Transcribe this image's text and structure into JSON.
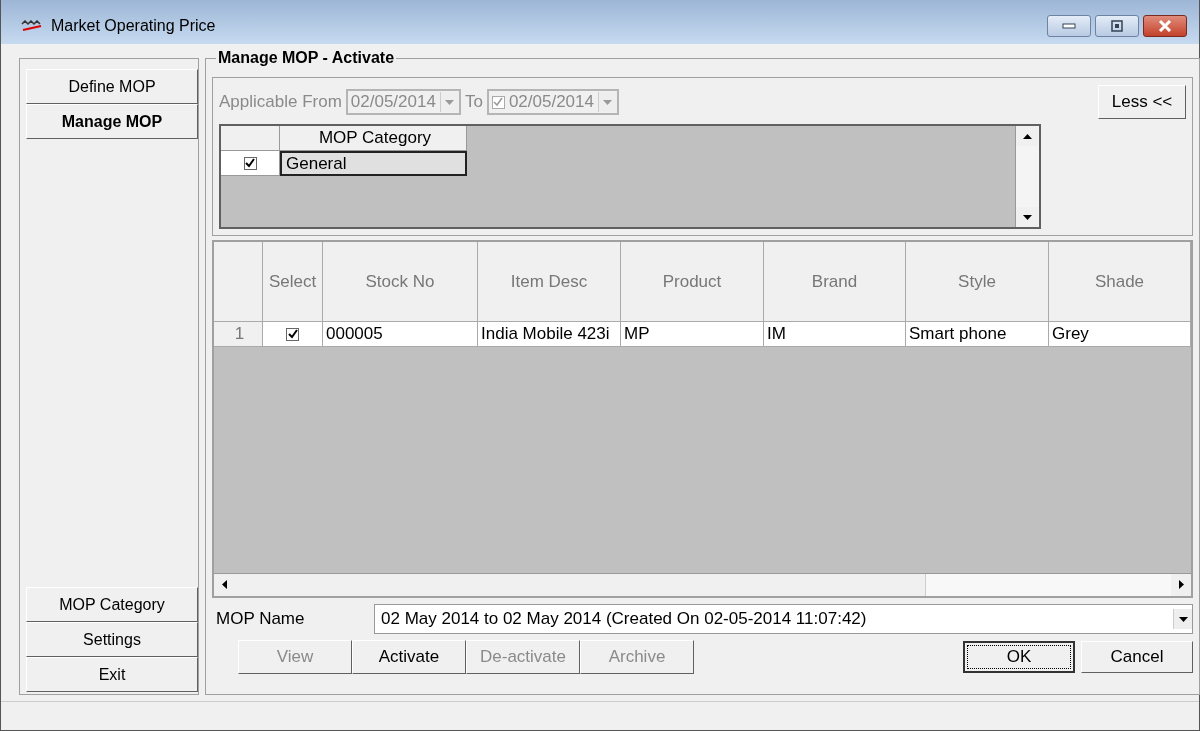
{
  "window": {
    "title": "Market Operating Price"
  },
  "sidebar": {
    "top_buttons": [
      {
        "label": "Define MOP",
        "selected": false
      },
      {
        "label": "Manage MOP",
        "selected": true
      }
    ],
    "bottom_buttons": [
      {
        "label": "MOP Category"
      },
      {
        "label": "Settings"
      },
      {
        "label": "Exit"
      }
    ]
  },
  "panel": {
    "title": "Manage MOP - Activate"
  },
  "filter": {
    "from_label": "Applicable From",
    "from_date": "02/05/2014",
    "to_label": "To",
    "to_checked": true,
    "to_date": "02/05/2014",
    "disabled": true
  },
  "less_button": {
    "label": "Less <<"
  },
  "category_grid": {
    "header": "MOP Category",
    "rows": [
      {
        "checked": true,
        "name": "General"
      }
    ]
  },
  "table": {
    "columns": [
      "",
      "Select",
      "Stock No",
      "Item Desc",
      "Product",
      "Brand",
      "Style",
      "Shade"
    ],
    "rows": [
      {
        "cells": [
          "1",
          {
            "checked": true
          },
          "000005",
          "India Mobile 423i",
          "MP",
          "IM",
          "Smart phone",
          "Grey"
        ]
      }
    ]
  },
  "mop_name": {
    "label": "MOP Name",
    "value": "02 May 2014 to 02 May 2014 (Created On 02-05-2014 11:07:42)"
  },
  "action_buttons": [
    {
      "label": "View",
      "disabled": true
    },
    {
      "label": "Activate",
      "disabled": false
    },
    {
      "label": "De-activate",
      "disabled": true
    },
    {
      "label": "Archive",
      "disabled": true
    }
  ],
  "dialog_buttons": [
    {
      "label": "OK",
      "focused": true
    },
    {
      "label": "Cancel",
      "focused": false
    }
  ]
}
